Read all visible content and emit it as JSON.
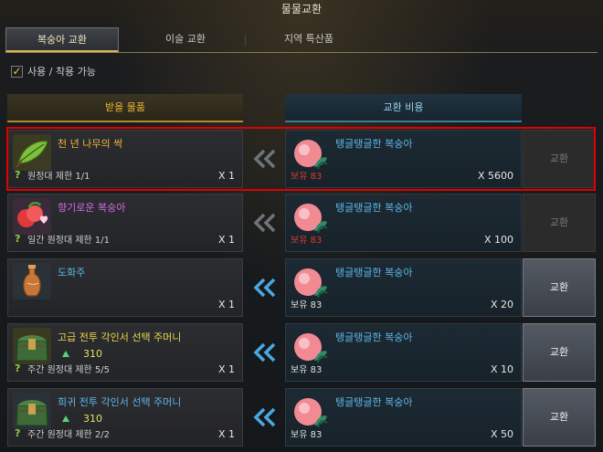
{
  "window": {
    "title": "물물교환"
  },
  "tabs": [
    {
      "label": "복숭아 교환",
      "active": true
    },
    {
      "label": "이슬 교환",
      "active": false
    },
    {
      "label": "지역 특산품",
      "active": false
    }
  ],
  "filter": {
    "label": "사용 / 착용 가능",
    "checked": true
  },
  "headers": {
    "reward": "받을 물품",
    "cost": "교환 비용"
  },
  "rows": [
    {
      "reward": {
        "name": "천 년 나무의 싹",
        "icon": "sprout-icon",
        "color": "gold",
        "limit": "원정대 제한 1/1",
        "qty": "X 1"
      },
      "cost": {
        "name": "탱글탱글한 복숭아",
        "icon": "peach-icon",
        "owned": "보유 83",
        "owned_color": "red",
        "qty": "X 5600"
      },
      "button": {
        "label": "교환",
        "enabled": false
      }
    },
    {
      "reward": {
        "name": "향기로운 복숭아",
        "icon": "peaches-heart-icon",
        "color": "purple",
        "limit": "일간 원정대 제한 1/1",
        "qty": "X 1"
      },
      "cost": {
        "name": "탱글탱글한 복숭아",
        "icon": "peach-icon",
        "owned": "보유 83",
        "owned_color": "red",
        "qty": "X 100"
      },
      "button": {
        "label": "교환",
        "enabled": false
      }
    },
    {
      "reward": {
        "name": "도화주",
        "icon": "wine-bottle-icon",
        "color": "blue",
        "limit": "",
        "qty": "X 1"
      },
      "cost": {
        "name": "탱글탱글한 복숭아",
        "icon": "peach-icon",
        "owned": "보유 83",
        "owned_color": "white",
        "qty": "X 20"
      },
      "button": {
        "label": "교환",
        "enabled": true
      }
    },
    {
      "reward": {
        "name": "고급 전투 각인서 선택 주머니",
        "icon": "pouch-icon",
        "color": "yellow",
        "sub_value": "310",
        "limit": "주간 원정대 제한 5/5",
        "qty": "X 1"
      },
      "cost": {
        "name": "탱글탱글한 복숭아",
        "icon": "peach-icon",
        "owned": "보유 83",
        "owned_color": "white",
        "qty": "X 10"
      },
      "button": {
        "label": "교환",
        "enabled": true
      }
    },
    {
      "reward": {
        "name": "희귀 전투 각인서 선택 주머니",
        "icon": "pouch-icon",
        "color": "blue",
        "sub_value": "310",
        "limit": "주간 원정대 제한 2/2",
        "qty": "X 1"
      },
      "cost": {
        "name": "탱글탱글한 복숭아",
        "icon": "peach-icon",
        "owned": "보유 83",
        "owned_color": "white",
        "qty": "X 50"
      },
      "button": {
        "label": "교환",
        "enabled": true
      }
    }
  ],
  "colors": {
    "highlight": "#e00000",
    "tab_accent": "#d9b35a",
    "red_text": "#e23a2a"
  }
}
